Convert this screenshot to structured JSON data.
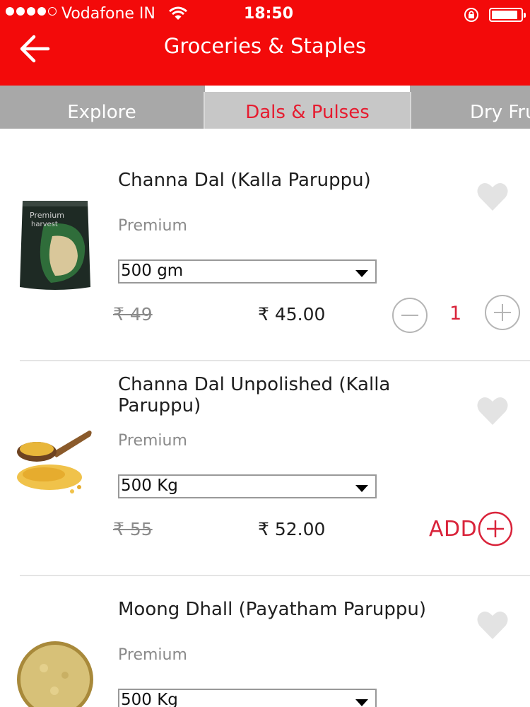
{
  "status_bar": {
    "carrier": "Vodafone IN",
    "time": "18:50",
    "signal_bars": 4,
    "battery_level": 0.9
  },
  "header": {
    "title": "Groceries & Staples",
    "background_color": "#f30a0a"
  },
  "tabs": [
    {
      "label": "Explore",
      "selected": false
    },
    {
      "label": "Dals & Pulses",
      "selected": true
    },
    {
      "label": "Dry Fru",
      "selected": false
    }
  ],
  "accent_color": "#d9233a",
  "products": [
    {
      "name": "Channa Dal (Kalla Paruppu)",
      "brand": "Premium",
      "pack_size": "500 gm",
      "mrp": "₹ 49",
      "price": "₹ 45.00",
      "quantity": "1",
      "image_icon": "channa-dal-pack-image"
    },
    {
      "name": "Channa Dal Unpolished (Kalla Paruppu)",
      "brand": "Premium",
      "pack_size": "500 Kg",
      "mrp": "₹ 55",
      "price": "₹ 52.00",
      "add_label": "ADD",
      "image_icon": "dal-wooden-spoon-image"
    },
    {
      "name": "Moong Dhall (Payatham Paruppu)",
      "brand": "Premium",
      "pack_size": "500 Kg",
      "image_icon": "moong-dal-bowl-image"
    }
  ]
}
